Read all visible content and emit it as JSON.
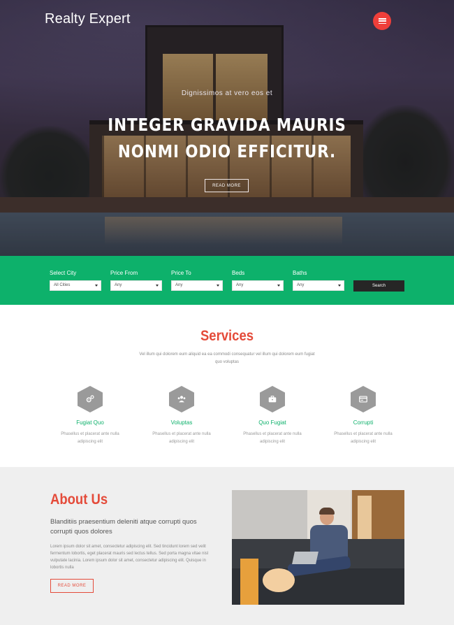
{
  "header": {
    "brand": "Realty Expert"
  },
  "hero": {
    "subtitle": "Dignissimos at vero eos et",
    "title": "INTEGER GRAVIDA MAURIS NONMI ODIO EFFICITUR.",
    "button": "READ MORE"
  },
  "search": {
    "fields": [
      {
        "label": "Select City",
        "value": "All Cities"
      },
      {
        "label": "Price From",
        "value": "Any"
      },
      {
        "label": "Price To",
        "value": "Any"
      },
      {
        "label": "Beds",
        "value": "Any"
      },
      {
        "label": "Baths",
        "value": "Any"
      }
    ],
    "button": "Search"
  },
  "services": {
    "title": "Services",
    "description": "Vel illum qui dolorem eum aliquid ea ea commodi consequatur vel illum qui dolorem eum fugiat quo voluptas",
    "items": [
      {
        "icon": "gears-icon",
        "name": "Fugiat Quo",
        "text": "Phasellus et placerat ante nulla adipiscing elit"
      },
      {
        "icon": "users-icon",
        "name": "Voluptas",
        "text": "Phasellus et placerat ante nulla adipiscing elit"
      },
      {
        "icon": "briefcase-icon",
        "name": "Quo Fugiat",
        "text": "Phasellus et placerat ante nulla adipiscing elit"
      },
      {
        "icon": "card-icon",
        "name": "Corrupti",
        "text": "Phasellus et placerat ante nulla adipiscing elit"
      }
    ]
  },
  "about": {
    "title": "About Us",
    "lead": "Blanditiis praesentium deleniti atque corrupti quos corrupti quos dolores",
    "body": "Lorem ipsum dolor sit amet, consectetur adipiscing elit. Sed tincidunt lorem sed velit fermentum lobortis, eget placerat mauris sed lectus tellus. Sed porta magna vitae nisl vulputate lacinia. Lorem ipsum dolor sit amet, consectetur adipiscing elit. Quisque in lobortis nulla",
    "button": "READ MORE"
  },
  "colors": {
    "accent": "#e44b3a",
    "green": "#0db16b",
    "menu": "#ef3f3a",
    "dark": "#262626"
  }
}
